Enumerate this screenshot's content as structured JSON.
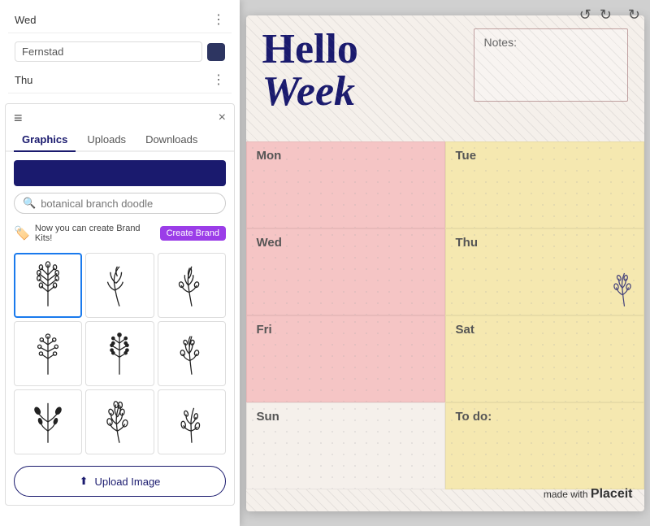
{
  "left_panel": {
    "schedule_items": [
      {
        "day": "Wed",
        "id": "wed-item"
      },
      {
        "name": "Fernstad",
        "id": "fernstad-item"
      },
      {
        "day": "Thu",
        "id": "thu-item"
      }
    ],
    "close_label": "×",
    "lines_label": "≡",
    "tabs": [
      {
        "id": "graphics",
        "label": "Graphics",
        "active": true
      },
      {
        "id": "uploads",
        "label": "Uploads",
        "active": false
      },
      {
        "id": "downloads",
        "label": "Downloads",
        "active": false
      }
    ],
    "search": {
      "placeholder": "botanical branch doodle",
      "value": "botanical branch doodle"
    },
    "brand_banner": {
      "text": "Now you can create Brand Kits!",
      "button_label": "Create Brand"
    },
    "upload_button": {
      "label": "Upload Image",
      "icon": "↑"
    }
  },
  "toolbar": {
    "undo_label": "↺",
    "redo_label": "↻",
    "refresh_label": "↻"
  },
  "planner": {
    "title_hello": "Hello",
    "title_week": "Week",
    "notes_label": "Notes:",
    "days": [
      {
        "label": "Mon",
        "color": "pink"
      },
      {
        "label": "Tue",
        "color": "yellow"
      },
      {
        "label": "Wed",
        "color": "pink"
      },
      {
        "label": "Thu",
        "color": "yellow"
      },
      {
        "label": "Fri",
        "color": "pink"
      },
      {
        "label": "Sat",
        "color": "yellow"
      },
      {
        "label": "Sun",
        "color": "plain"
      },
      {
        "label": "To do:",
        "color": "yellow"
      }
    ],
    "watermark": "made with ",
    "watermark_brand": "Placeit"
  }
}
